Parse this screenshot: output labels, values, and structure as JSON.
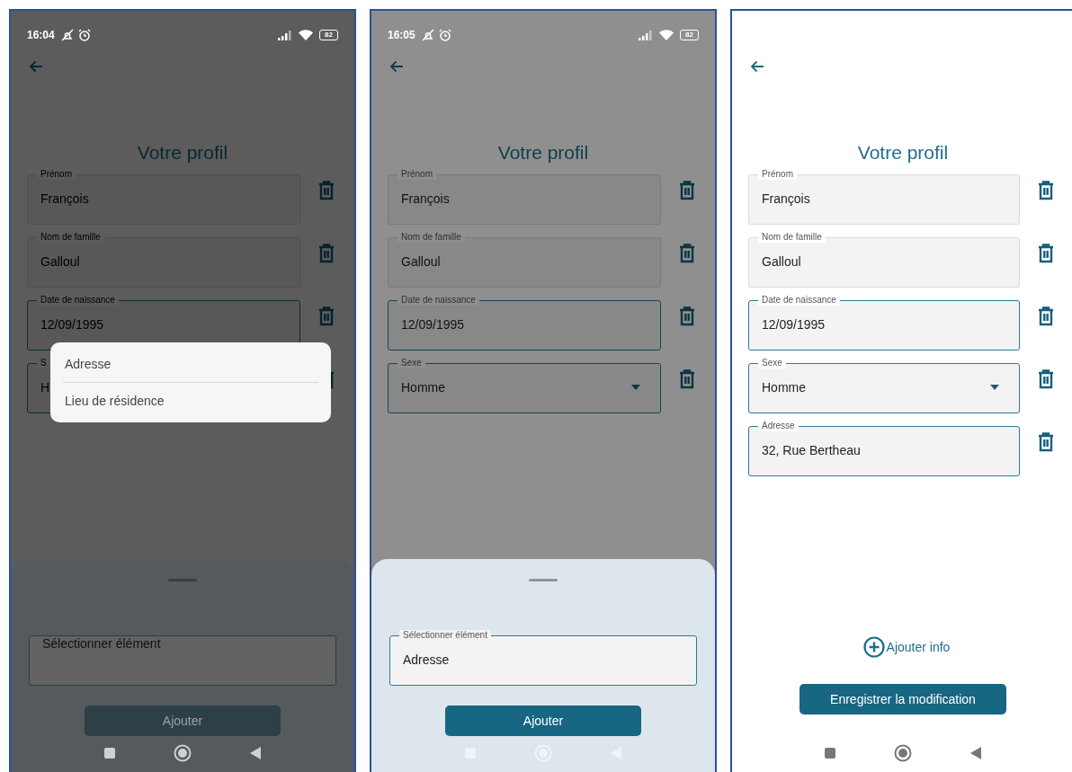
{
  "screens": [
    {
      "kind": "menu-open",
      "status_bar": {
        "time": "16:04",
        "battery": "82"
      },
      "title": "Votre profil",
      "fields": [
        {
          "kind": "text",
          "label": "Prénom",
          "value": "François",
          "focused": false
        },
        {
          "kind": "text",
          "label": "Nom de famille",
          "value": "Galloul",
          "focused": false
        },
        {
          "kind": "text",
          "label": "Date de naissance",
          "value": "12/09/1995",
          "focused": true
        },
        {
          "kind": "select",
          "label": "S",
          "value": "H",
          "focused": true
        }
      ],
      "menu": {
        "items": [
          "Adresse",
          "Lieu de résidence"
        ]
      },
      "sheet": {
        "field": {
          "placeholder": "Sélectionner élément"
        },
        "button": {
          "label": "Ajouter",
          "disabled": true
        }
      }
    },
    {
      "kind": "sheet-open",
      "status_bar": {
        "time": "16:05",
        "battery": "82"
      },
      "title": "Votre profil",
      "fields": [
        {
          "kind": "text",
          "label": "Prénom",
          "value": "François",
          "focused": false
        },
        {
          "kind": "text",
          "label": "Nom de famille",
          "value": "Galloul",
          "focused": false
        },
        {
          "kind": "text",
          "label": "Date de naissance",
          "value": "12/09/1995",
          "focused": true
        },
        {
          "kind": "select",
          "label": "Sexe",
          "value": "Homme",
          "focused": true
        }
      ],
      "sheet": {
        "field": {
          "label": "Sélectionner élément",
          "value": "Adresse"
        },
        "button": {
          "label": "Ajouter",
          "disabled": false
        }
      }
    },
    {
      "kind": "form",
      "title": "Votre profil",
      "fields": [
        {
          "kind": "text",
          "label": "Prénom",
          "value": "François",
          "focused": false
        },
        {
          "kind": "text",
          "label": "Nom de famille",
          "value": "Galloul",
          "focused": false
        },
        {
          "kind": "text",
          "label": "Date de naissance",
          "value": "12/09/1995",
          "focused": true
        },
        {
          "kind": "select",
          "label": "Sexe",
          "value": "Homme",
          "focused": true
        },
        {
          "kind": "text",
          "label": "Adresse",
          "value": "32, Rue Bertheau",
          "focused": true
        }
      ],
      "add_info": "Ajouter info",
      "save_button": "Enregistrer la modification"
    }
  ]
}
